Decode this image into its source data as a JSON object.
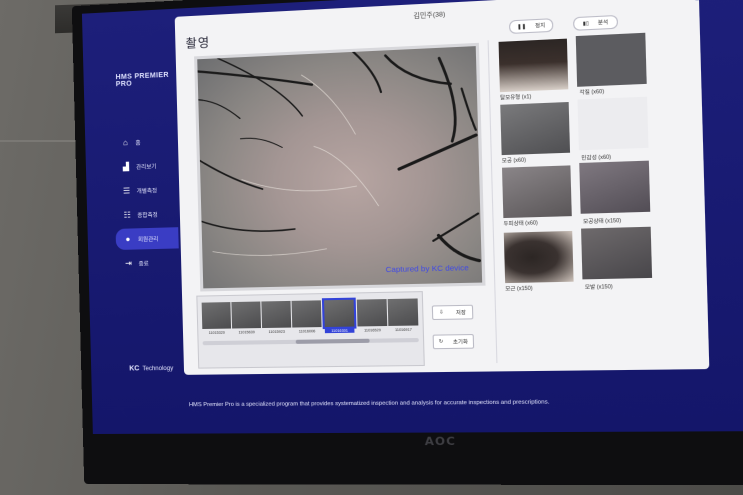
{
  "bezel_logo": "AOC",
  "sidebar": {
    "app_title": "HMS PREMIER PRO",
    "items": [
      {
        "label": "홈",
        "icon": "home-icon"
      },
      {
        "label": "관리보기",
        "icon": "chart-icon"
      },
      {
        "label": "개별측정",
        "icon": "list-icon"
      },
      {
        "label": "종합측정",
        "icon": "list-icon"
      },
      {
        "label": "회원관리",
        "icon": "person-icon"
      },
      {
        "label": "종료",
        "icon": "exit-icon"
      }
    ],
    "active_index": 4,
    "company": {
      "mark": "KC",
      "name": "Technology"
    }
  },
  "dialog": {
    "title": "김민주(38)",
    "close_icon": "close-icon",
    "section_title": "촬영"
  },
  "viewer": {
    "capture_label": "Captured by KC device"
  },
  "filmstrip": {
    "thumbnails": [
      {
        "label": "11015320"
      },
      {
        "label": "11015639"
      },
      {
        "label": "11015923"
      },
      {
        "label": "11016006"
      },
      {
        "label": "11016301",
        "selected": true
      },
      {
        "label": "11016529"
      },
      {
        "label": "11016917"
      }
    ]
  },
  "actions": {
    "save_label": "저장",
    "reset_label": "초기화"
  },
  "toggles": {
    "left_label": "정지",
    "right_label": "분석"
  },
  "analysis_grid": [
    {
      "label": "탈모유형 (x1)"
    },
    {
      "label": "각질 (x60)"
    },
    {
      "label": "모공 (x60)"
    },
    {
      "label": "민감성 (x60)"
    },
    {
      "label": "두피상태 (x60)"
    },
    {
      "label": "모공상태 (x150)"
    },
    {
      "label": "모근 (x150)"
    },
    {
      "label": "모발 (x150)"
    }
  ],
  "footer": {
    "text": "HMS Premier Pro is a specialized program that provides systematized inspection and analysis for accurate inspections and prescriptions."
  },
  "colors": {
    "screen_bg": "#1d1f7a",
    "accent": "#3343d8",
    "panel_bg": "#f3f3f5"
  }
}
